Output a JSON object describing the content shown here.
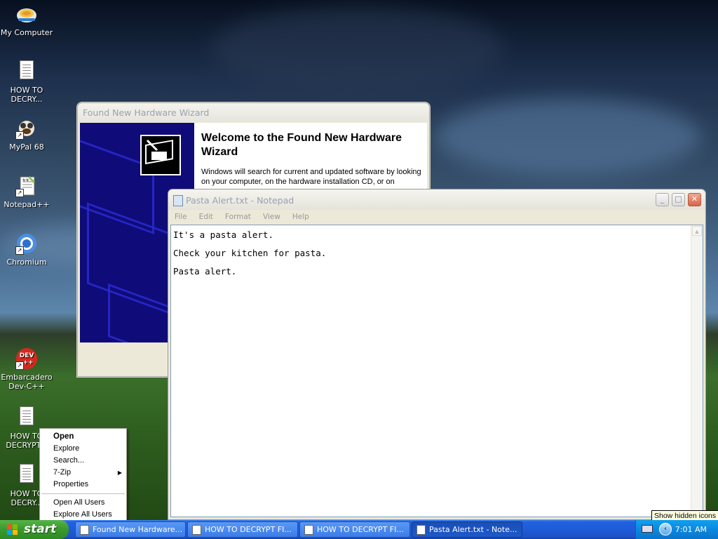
{
  "desktop": {
    "icons": [
      {
        "label": "My Computer"
      },
      {
        "label": "HOW TO DECRY..."
      },
      {
        "label": "MyPal 68"
      },
      {
        "label": "Notepad++"
      },
      {
        "label": "Chromium"
      },
      {
        "label": "Embarcadero Dev-C++"
      },
      {
        "label": "HOW TO DECRYPT..."
      },
      {
        "label": "HOW TO DECRY..."
      }
    ],
    "devcpp_badge": "DEV\n++"
  },
  "wizard": {
    "title": "Found New Hardware Wizard",
    "heading": "Welcome to the Found New Hardware Wizard",
    "body_text": "Windows will search for current and updated software by looking on your computer, on the hardware installation CD, or on"
  },
  "notepad": {
    "title": "Pasta Alert.txt - Notepad",
    "menu": [
      "File",
      "Edit",
      "Format",
      "View",
      "Help"
    ],
    "lines": [
      "It's a pasta alert.",
      "Check your kitchen for pasta.",
      "Pasta alert."
    ],
    "controls": {
      "minimize": "_",
      "maximize": "□",
      "close": "✕"
    }
  },
  "context_menu": {
    "items": [
      {
        "label": "Open",
        "bold": true
      },
      {
        "label": "Explore"
      },
      {
        "label": "Search..."
      },
      {
        "label": "7-Zip",
        "submenu": true
      },
      {
        "label": "Properties"
      },
      {
        "label": "Open All Users"
      },
      {
        "label": "Explore All Users"
      }
    ]
  },
  "taskbar": {
    "start_label": "start",
    "tasks": [
      {
        "label": "Found New Hardware..."
      },
      {
        "label": "HOW TO DECRYPT FI..."
      },
      {
        "label": "HOW TO DECRYPT FI..."
      },
      {
        "label": "Pasta Alert.txt - Note..."
      }
    ],
    "clock": "7:01 AM",
    "tray_chevron": "‹",
    "tooltip": "Show hidden icons"
  },
  "colors": {
    "taskbar_blue": "#1e5bd8",
    "start_green": "#3c9a2f",
    "wizard_sidebar": "#0f0c7a",
    "tray_blue": "#0c88e0"
  }
}
